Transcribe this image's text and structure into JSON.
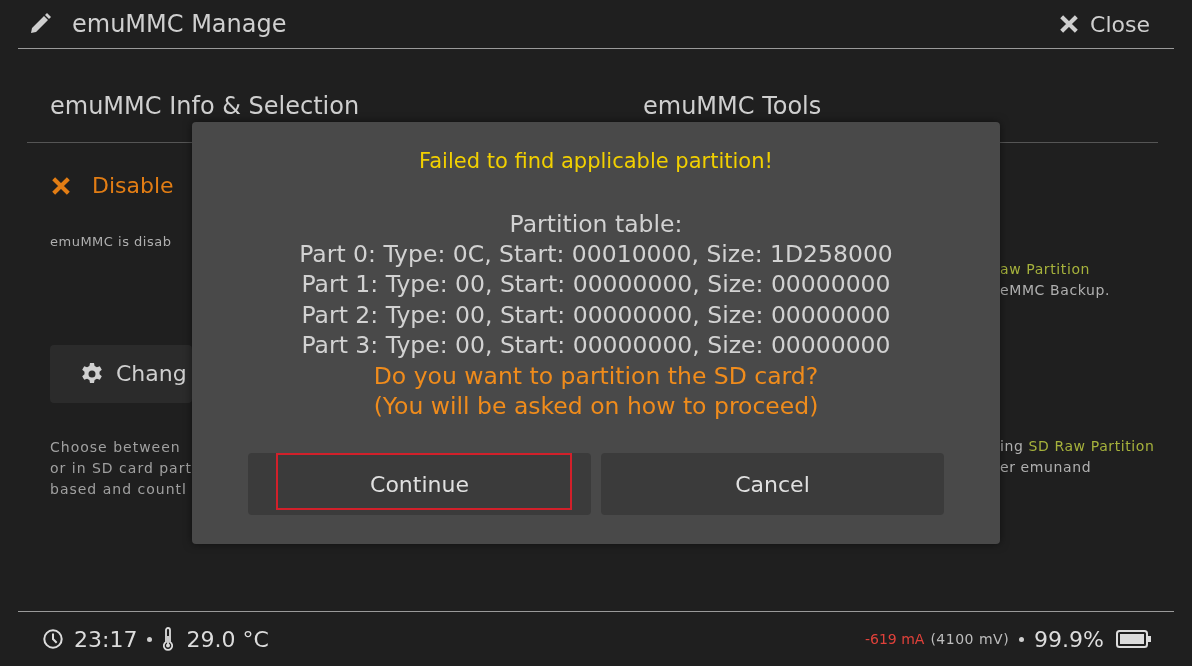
{
  "header": {
    "title": "emuMMC Manage",
    "close_label": "Close"
  },
  "left_panel": {
    "heading": "emuMMC Info & Selection",
    "status": {
      "text": "Disable",
      "enabled": false
    },
    "description": "emuMMC is disab",
    "button_label": "Chang",
    "note_lines": [
      "Choose between",
      "or in SD card part",
      "based and countl"
    ]
  },
  "right_panel": {
    "heading": "emuMMC Tools",
    "lines": [
      [
        {
          "text": "aw Partition",
          "highlight": true
        }
      ],
      [
        {
          "text": "eMMC Backup.",
          "highlight": false
        }
      ],
      [
        {
          "text": "ing ",
          "highlight": false
        },
        {
          "text": "SD Raw Partition",
          "highlight": true
        }
      ],
      [
        {
          "text": "er emunand",
          "highlight": false
        }
      ]
    ]
  },
  "dialog": {
    "title": "Failed to find applicable partition!",
    "lines": [
      {
        "text": "Partition table:",
        "kind": "info"
      },
      {
        "text": "Part 0: Type: 0C, Start: 00010000, Size: 1D258000",
        "kind": "info"
      },
      {
        "text": "Part 1: Type: 00, Start: 00000000, Size: 00000000",
        "kind": "info"
      },
      {
        "text": "Part 2: Type: 00, Start: 00000000, Size: 00000000",
        "kind": "info"
      },
      {
        "text": "Part 3: Type: 00, Start: 00000000, Size: 00000000",
        "kind": "info"
      },
      {
        "text": "Do you want to partition the SD card?",
        "kind": "prompt"
      },
      {
        "text": "(You will be asked on how to proceed)",
        "kind": "prompt"
      }
    ],
    "buttons": [
      {
        "label": "Continue",
        "selected": true
      },
      {
        "label": "Cancel",
        "selected": false
      }
    ]
  },
  "status_bar": {
    "time": "23:17",
    "temperature": "29.0 °C",
    "current": "-619 mA",
    "voltage": "(4100 mV)",
    "battery": "99.9%"
  }
}
